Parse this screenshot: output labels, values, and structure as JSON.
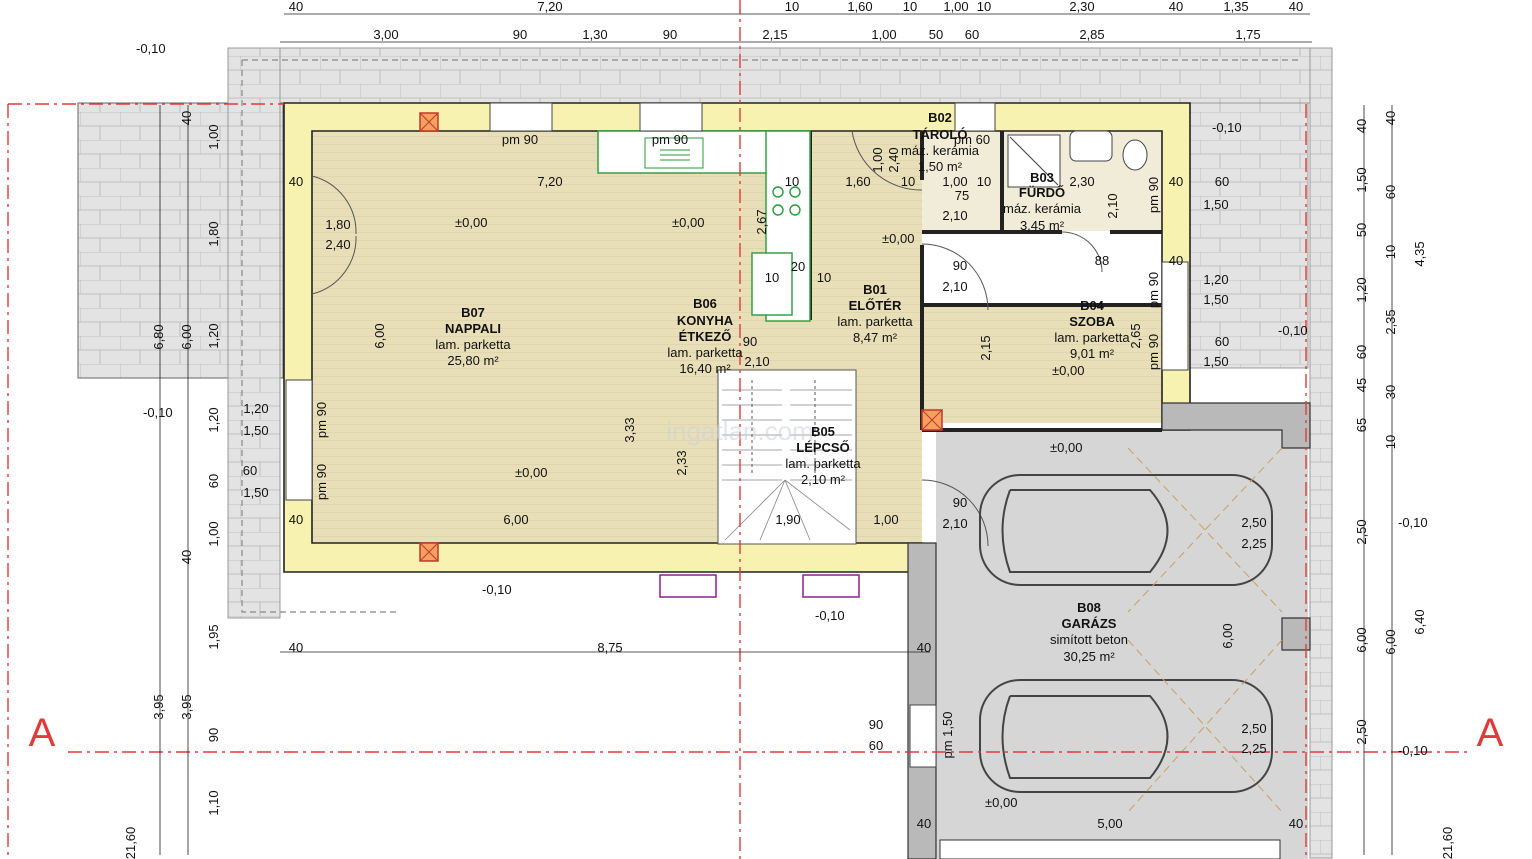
{
  "rooms": [
    {
      "id": "B07",
      "name": "NAPPALI",
      "floor": "lam. parketta",
      "area": "25,80 m²"
    },
    {
      "id": "B06",
      "name": "KONYHA",
      "name2": "ÉTKEZŐ",
      "floor": "lam. parketta",
      "area": "16,40 m²"
    },
    {
      "id": "B01",
      "name": "ELŐTÉR",
      "floor": "lam. parketta",
      "area": "8,47 m²"
    },
    {
      "id": "B02",
      "name": "TÁROLÓ",
      "floor": "máz. kerámia",
      "area": "1,50 m²"
    },
    {
      "id": "B03",
      "name": "FÜRDŐ",
      "floor": "máz. kerámia",
      "area": "3,45 m²"
    },
    {
      "id": "B04",
      "name": "SZOBA",
      "floor": "lam. parketta",
      "area": "9,01 m²"
    },
    {
      "id": "B05",
      "name": "LÉPCSŐ",
      "floor": "lam. parketta",
      "area": "2,10 m²"
    },
    {
      "id": "B08",
      "name": "GARÁZS",
      "floor": "simított beton",
      "area": "30,25 m²"
    }
  ],
  "levels": {
    "zero": "±0,00",
    "minus": "-0,10"
  },
  "section_mark": "A",
  "watermark": "ingatlan.com",
  "top_dims_row1": [
    "40",
    "7,20",
    "10",
    "1,60",
    "10",
    "1,00",
    "10",
    "2,30",
    "40",
    "1,35",
    "40"
  ],
  "top_dims_row2": [
    "3,00",
    "90",
    "1,30",
    "90",
    "2,15",
    "1,00",
    "50",
    "60",
    "2,85",
    "1,75"
  ],
  "window_labels": {
    "pm90": "pm 90",
    "pm60": "pm 60",
    "pm150": "pm 1,50"
  },
  "interior_dims": {
    "d720": "7,20",
    "d160": "1,60",
    "d100": "1,00",
    "d230": "2,30",
    "d40": "40",
    "d10": "10",
    "d75": "75",
    "d210": "2,10",
    "d90": "90",
    "d120": "1,20",
    "d150": "1,50",
    "d60": "60",
    "d180": "1,80",
    "d240": "2,40",
    "d600": "6,00",
    "d333": "3,33",
    "d233": "2,33",
    "d267": "2,67",
    "d20": "20",
    "d88": "88",
    "d215": "2,15",
    "d265": "2,65",
    "d190": "1,90",
    "d875": "8,75",
    "d500": "5,00",
    "d250": "2,50",
    "d225": "2,25",
    "d680": "6,80"
  },
  "left_dims": [
    "40",
    "1,00",
    "1,80",
    "1,20",
    "1,20",
    "60",
    "1,00",
    "40",
    "1,95",
    "90",
    "1,10"
  ],
  "left_dims2": [
    "6,80",
    "6,00",
    "3,95",
    "3,95",
    "21,60"
  ],
  "right_dims": [
    "40",
    "1,50",
    "60",
    "50",
    "10",
    "4,35",
    "1,20",
    "2,35",
    "60",
    "45",
    "30",
    "65",
    "10",
    "2,50",
    "6,40",
    "6,00",
    "2,50",
    "21,60"
  ],
  "colors": {
    "wall": "#f7f2b0",
    "floor": "#e8dfb8",
    "garage": "#d6d6d6",
    "paving": "#e3e3e3",
    "refline": "#e23a3a",
    "fixture": "#2a9a3a",
    "column": "#c0392b",
    "purple": "#8e1e8e"
  }
}
